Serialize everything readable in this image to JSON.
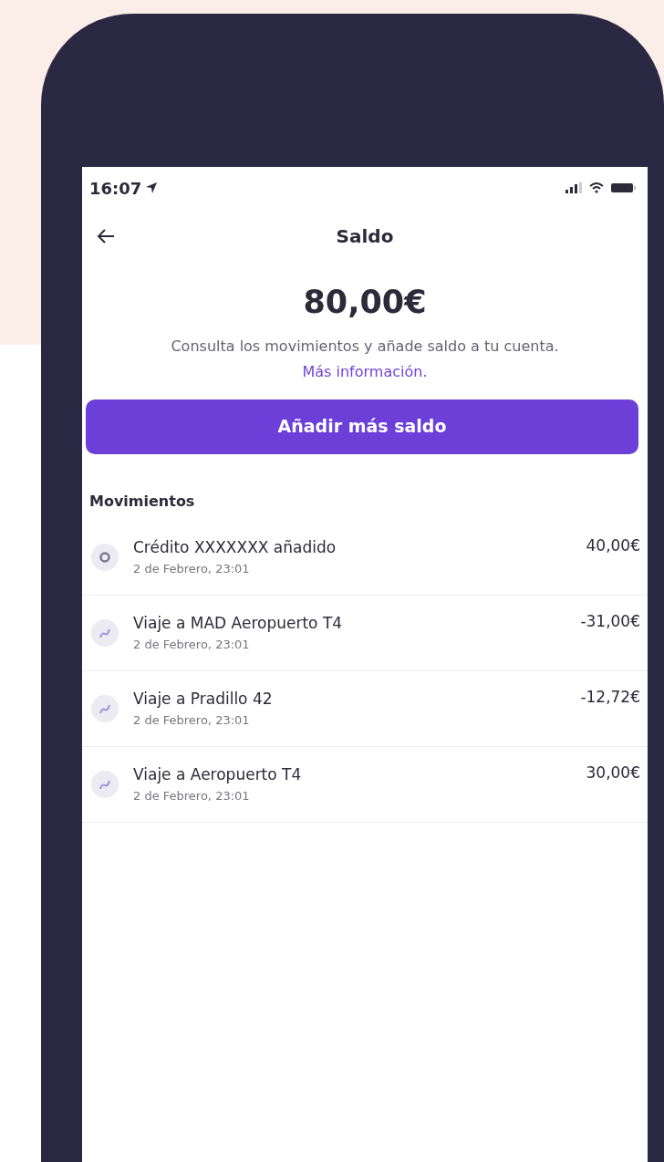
{
  "status_bar": {
    "time": "16:07"
  },
  "header": {
    "title": "Saldo"
  },
  "balance": {
    "amount": "80,00€",
    "description": "Consulta los movimientos y añade saldo a tu cuenta.",
    "link": "Más información."
  },
  "primary_button": {
    "label": "Añadir más saldo"
  },
  "movements": {
    "heading": "Movimientos",
    "items": [
      {
        "kind": "credit",
        "title": "Crédito XXXXXXX añadido",
        "date": "2 de Febrero, 23:01",
        "amount": "40,00€"
      },
      {
        "kind": "trip",
        "title": "Viaje a MAD Aeropuerto T4",
        "date": "2 de Febrero, 23:01",
        "amount": "-31,00€"
      },
      {
        "kind": "trip",
        "title": "Viaje a Pradillo 42",
        "date": "2 de Febrero, 23:01",
        "amount": "-12,72€"
      },
      {
        "kind": "trip",
        "title": "Viaje a Aeropuerto T4",
        "date": "2 de Febrero, 23:01",
        "amount": "30,00€"
      }
    ]
  }
}
